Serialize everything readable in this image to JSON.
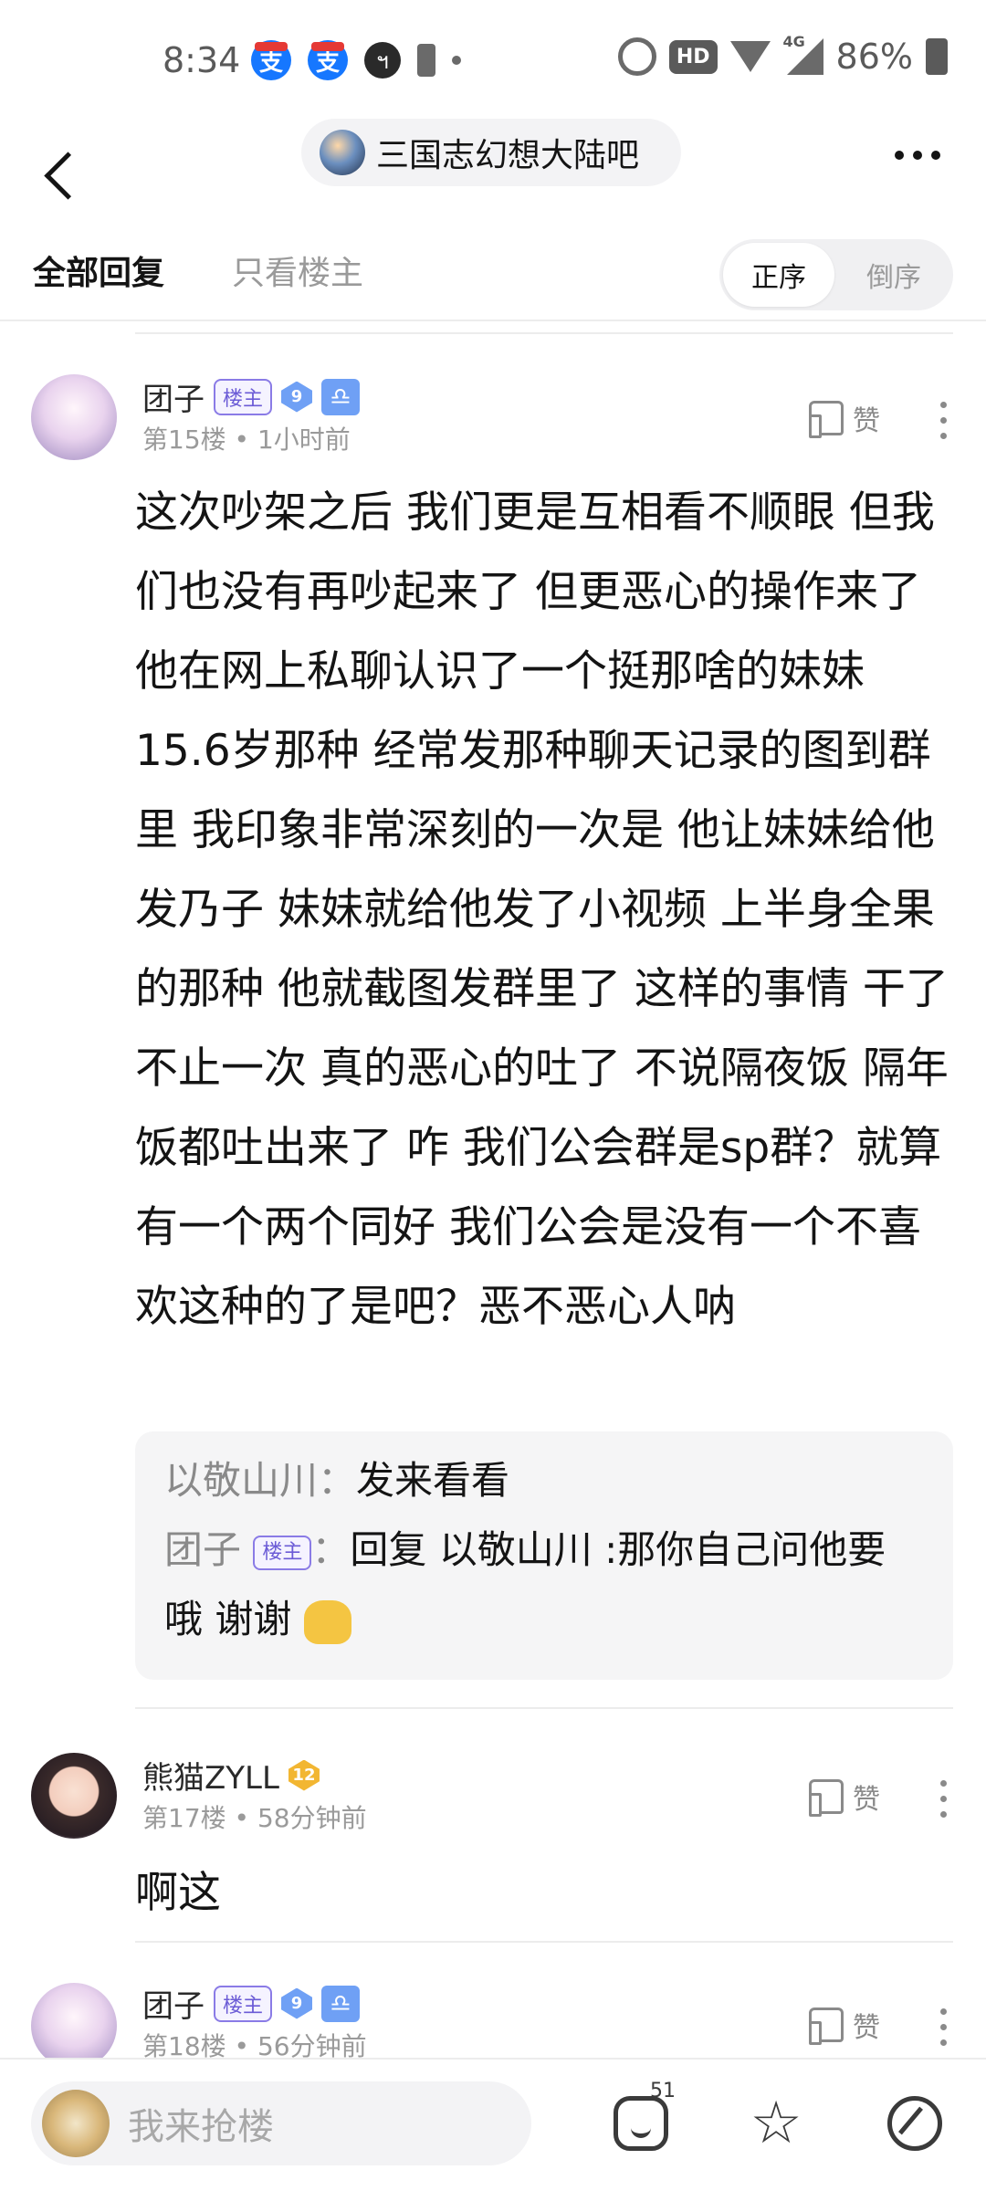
{
  "status_bar": {
    "time": "8:34",
    "hd": "HD",
    "network": "4G",
    "battery": "86%"
  },
  "header": {
    "forum_name": "三国志幻想大陆吧"
  },
  "tabs": {
    "all_replies": "全部回复",
    "host_only": "只看楼主",
    "order_asc": "正序",
    "order_desc": "倒序"
  },
  "posts": [
    {
      "author": "团子",
      "lz_badge": "楼主",
      "level": "9",
      "floor": "第15楼",
      "time": "1小时前",
      "like": "赞",
      "body": "这次吵架之后 我们更是互相看不顺眼 但我们也没有再吵起来了 但更恶心的操作来了 他在网上私聊认识了一个挺那啥的妹妹15.6岁那种 经常发那种聊天记录的图到群里 我印象非常深刻的一次是 他让妹妹给他发乃子 妹妹就给他发了小视频 上半身全果的那种 他就截图发群里了 这样的事情 干了不止一次 真的恶心的吐了 不说隔夜饭 隔年饭都吐出来了 咋 我们公会群是sp群？就算有一个两个同好 我们公会是没有一个不喜欢这种的了是吧？恶不恶心人呐",
      "replies": [
        {
          "author": "以敬山川",
          "text": "发来看看"
        },
        {
          "author": "团子",
          "lz_badge": "楼主",
          "text": "回复 以敬山川 :那你自己问他要哦 谢谢"
        }
      ]
    },
    {
      "author": "熊猫ZYLL",
      "level": "12",
      "floor": "第17楼",
      "time": "58分钟前",
      "like": "赞",
      "body": "啊这"
    },
    {
      "author": "团子",
      "lz_badge": "楼主",
      "level": "9",
      "floor": "第18楼",
      "time": "56分钟前",
      "like": "赞"
    }
  ],
  "bottom_bar": {
    "placeholder": "我来抢楼",
    "comment_count": "51"
  }
}
